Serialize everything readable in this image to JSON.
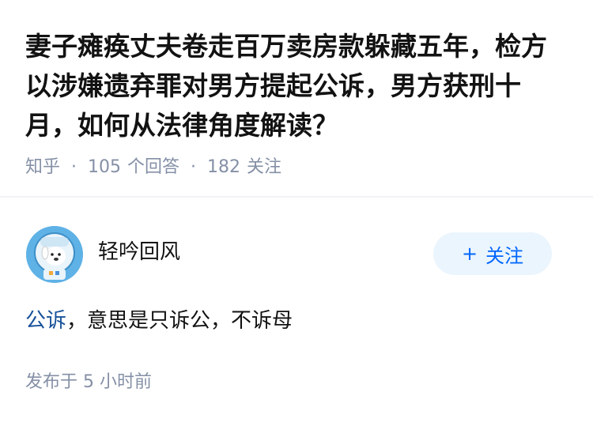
{
  "question": {
    "title": "妻子瘫痪丈夫卷走百万卖房款躲藏五年，检方以涉嫌遗弃罪对男方提起公诉，男方获刑十月，如何从法律角度解读？"
  },
  "meta": {
    "source": "知乎",
    "answer_count": "105",
    "answer_label": "个回答",
    "follower_count": "182",
    "follower_label": "关注"
  },
  "author": {
    "name": "轻吟回风"
  },
  "follow_button": {
    "plus": "+",
    "label": "关注"
  },
  "answer": {
    "link_text": "公诉",
    "text": "，意思是只诉公，不诉母"
  },
  "timestamp": {
    "prefix": "发布于",
    "value": "5 小时前"
  },
  "colors": {
    "link": "#175199",
    "follow_text": "#0066ff",
    "follow_bg": "#ebf5fd",
    "meta_text": "#8590a6"
  }
}
